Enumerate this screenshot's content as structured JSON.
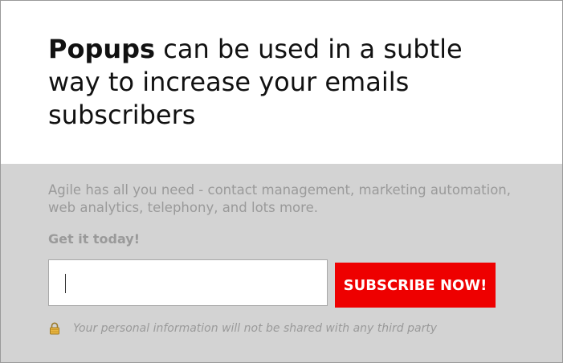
{
  "popup": {
    "headline_strong": "Popups",
    "headline_rest": " can be used in a subtle way to increase your emails subscribers",
    "description": "Agile has all you need - contact management, marketing automation, web analytics, telephony, and lots more.",
    "cta_text": "Get it today!",
    "email_field": {
      "value": "",
      "placeholder": ""
    },
    "subscribe_label": "SUBSCRIBE NOW!",
    "privacy_text": "Your personal information will not be shared with any third party",
    "lock_icon": "lock-icon",
    "colors": {
      "accent": "#ee0000",
      "panel_background": "#d3d3d3",
      "muted_text": "#9a9a9a",
      "headline_text": "#111111"
    }
  }
}
